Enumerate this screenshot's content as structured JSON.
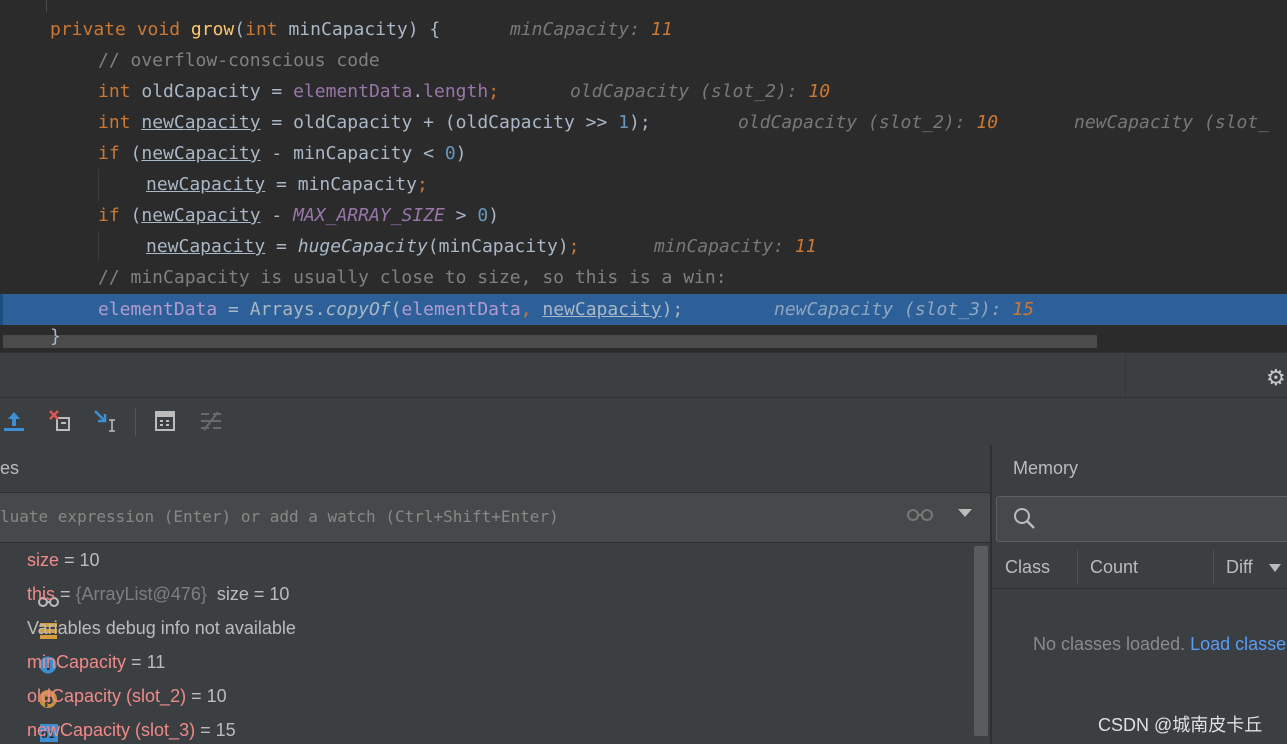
{
  "editor": {
    "lines": {
      "l1": {
        "kw1": "private",
        "kw2": "void",
        "fn": "grow",
        "open": "(",
        "kw3": "int",
        "param": "minCapacity",
        "close": ") {",
        "hint_name": "minCapacity:",
        "hint_val": "11"
      },
      "l2": {
        "comment": "// overflow-conscious code"
      },
      "l3": {
        "kw": "int",
        "var": "oldCapacity",
        "eq": " = ",
        "obj": "elementData",
        "dot": ".",
        "field": "length",
        "semi": ";",
        "hint_name": "oldCapacity (slot_2):",
        "hint_val": "10"
      },
      "l4": {
        "kw": "int",
        "var": "newCapacity",
        "eq": " = oldCapacity + (oldCapacity >> ",
        "num": "1",
        "end": ");",
        "hint1_name": "oldCapacity (slot_2):",
        "hint1_val": "10",
        "hint2_name": "newCapacity (slot_"
      },
      "l5": {
        "kw": "if",
        "open": " (",
        "var": "newCapacity",
        "rest": " - minCapacity < ",
        "num": "0",
        "close": ")"
      },
      "l6": {
        "var": "newCapacity",
        "rest": " = minCapacity",
        "semi": ";"
      },
      "l7": {
        "kw": "if",
        "open": " (",
        "var": "newCapacity",
        "mid": " - ",
        "const": "MAX_ARRAY_SIZE",
        "rest": " > ",
        "num": "0",
        "close": ")"
      },
      "l8": {
        "var": "newCapacity",
        "eq": " = ",
        "call": "hugeCapacity",
        "rest": "(minCapacity)",
        "semi": ";",
        "hint_name": "minCapacity:",
        "hint_val": "11"
      },
      "l9": {
        "comment": "// minCapacity is usually close to size, so this is a win:"
      },
      "l10": {
        "obj": "elementData",
        "eq": " = Arrays.",
        "call": "copyOf",
        "open": "(",
        "arg1": "elementData",
        "comma": ", ",
        "arg2": "newCapacity",
        "end": ");",
        "hint_name": "newCapacity (slot_3):",
        "hint_val": "15"
      },
      "l11": {
        "brace": "}"
      }
    }
  },
  "debugger": {
    "variables_title": "es",
    "eval_placeholder": "luate expression (Enter) or add a watch (Ctrl+Shift+Enter)",
    "variables": [
      {
        "name": "size",
        "sep": " = ",
        "value": "10",
        "icon": "watch-glasses-icon"
      },
      {
        "name": "this",
        "sep": " = ",
        "obj": "{ArrayList@476}",
        "value": "  size = 10",
        "icon": "object-icon"
      },
      {
        "info": "Variables debug info not available",
        "icon": "info-icon"
      },
      {
        "name": "minCapacity",
        "sep": " = ",
        "value": "11",
        "icon": "parameter-icon"
      },
      {
        "name": "oldCapacity (slot_2)",
        "sep": " = ",
        "value": "10",
        "icon": "primitive-icon"
      },
      {
        "name": "newCapacity (slot_3)",
        "sep": " = ",
        "value": "15",
        "icon": "primitive-icon"
      }
    ]
  },
  "memory": {
    "title": "Memory",
    "columns": [
      "Class",
      "Count",
      "Diff"
    ],
    "empty_text": "No classes loaded. ",
    "load_link": "Load classe"
  },
  "watermark": "CSDN @城南皮卡丘",
  "colors": {
    "accent_selection": "#2d6099",
    "editor_bg": "#2b2b2b",
    "panel_bg": "#3c3f41",
    "link": "#589df6"
  }
}
